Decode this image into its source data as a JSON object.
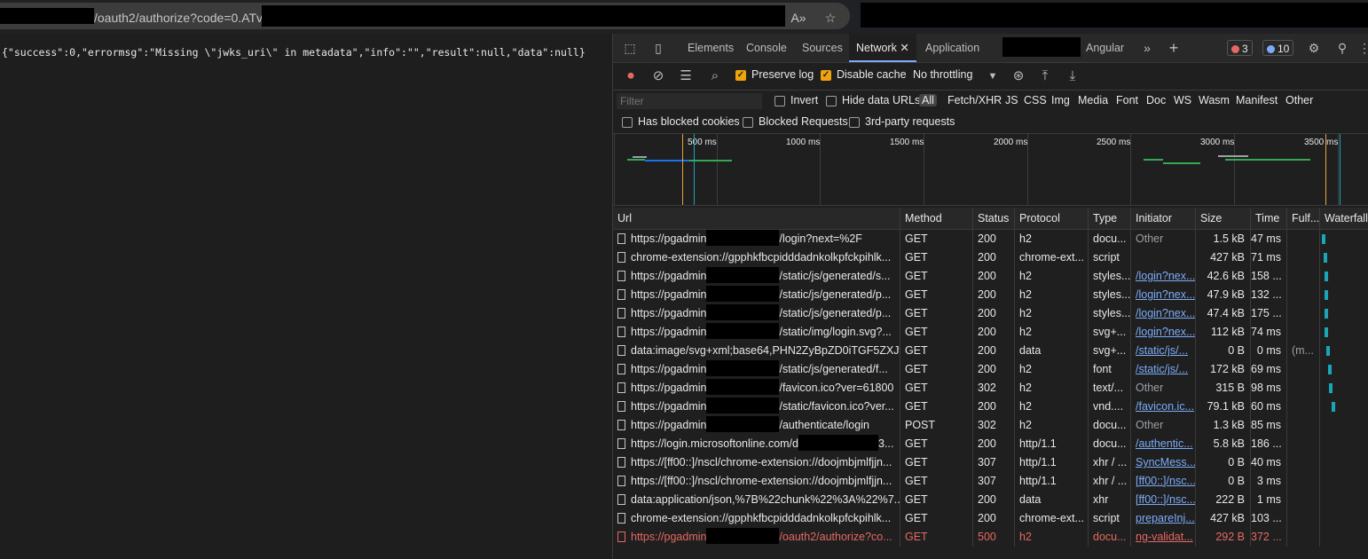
{
  "address_bar": {
    "url": "/oauth2/authorize?code=0.ATv",
    "reader_icon": "reader-mode-icon",
    "favorite_icon": "add-favorite-icon"
  },
  "page": {
    "json_text": "{\"success\":0,\"errormsg\":\"Missing \\\"jwks_uri\\\" in metadata\",\"info\":\"\",\"result\":null,\"data\":null}"
  },
  "devtools": {
    "tabs": [
      "Elements",
      "Console",
      "Sources",
      "Network",
      "Application",
      "Angular"
    ],
    "active_tab": "Network",
    "errors_count": "3",
    "info_count": "10",
    "toolbar": {
      "preserve_log": "Preserve log",
      "disable_cache": "Disable cache",
      "throttling": "No throttling"
    },
    "filter": {
      "placeholder": "Filter",
      "invert": "Invert",
      "hide_data_urls": "Hide data URLs",
      "types": [
        "All",
        "Fetch/XHR",
        "JS",
        "CSS",
        "Img",
        "Media",
        "Font",
        "Doc",
        "WS",
        "Wasm",
        "Manifest",
        "Other"
      ],
      "selected_type": "All"
    },
    "blocked": {
      "has_blocked_cookies": "Has blocked cookies",
      "blocked_requests": "Blocked Requests",
      "third_party": "3rd-party requests"
    },
    "overview_ticks": [
      "500 ms",
      "1000 ms",
      "1500 ms",
      "2000 ms",
      "2500 ms",
      "3000 ms",
      "3500 ms"
    ],
    "columns": [
      "Url",
      "Method",
      "Status",
      "Protocol",
      "Type",
      "Initiator",
      "Size",
      "Time",
      "Fulf...",
      "Waterfall"
    ],
    "rows": [
      {
        "url_a": "https://pgadmin",
        "url_b": "/login?next=%2F",
        "method": "GET",
        "status": "200",
        "protocol": "h2",
        "type": "docu...",
        "initiator": "Other",
        "initiator_link": false,
        "size": "1.5 kB",
        "time": "47 ms",
        "fulfilled": "",
        "redacted": true,
        "error": false
      },
      {
        "url_a": "chrome-extension://gpphkfbcpidddadnkolkpfckpihlk...",
        "url_b": "",
        "method": "GET",
        "status": "200",
        "protocol": "chrome-ext...",
        "type": "script",
        "initiator": "",
        "initiator_link": false,
        "size": "427 kB",
        "time": "71 ms",
        "fulfilled": "",
        "redacted": false,
        "error": false
      },
      {
        "url_a": "https://pgadmin",
        "url_b": "/static/js/generated/s...",
        "method": "GET",
        "status": "200",
        "protocol": "h2",
        "type": "styles...",
        "initiator": "/login?nex...",
        "initiator_link": true,
        "size": "42.6 kB",
        "time": "158 ...",
        "fulfilled": "",
        "redacted": true,
        "error": false
      },
      {
        "url_a": "https://pgadmin",
        "url_b": "/static/js/generated/p...",
        "method": "GET",
        "status": "200",
        "protocol": "h2",
        "type": "styles...",
        "initiator": "/login?nex...",
        "initiator_link": true,
        "size": "47.9 kB",
        "time": "132 ...",
        "fulfilled": "",
        "redacted": true,
        "error": false
      },
      {
        "url_a": "https://pgadmin",
        "url_b": "/static/js/generated/p...",
        "method": "GET",
        "status": "200",
        "protocol": "h2",
        "type": "styles...",
        "initiator": "/login?nex...",
        "initiator_link": true,
        "size": "47.4 kB",
        "time": "175 ...",
        "fulfilled": "",
        "redacted": true,
        "error": false
      },
      {
        "url_a": "https://pgadmin",
        "url_b": "/static/img/login.svg?...",
        "method": "GET",
        "status": "200",
        "protocol": "h2",
        "type": "svg+...",
        "initiator": "/login?nex...",
        "initiator_link": true,
        "size": "112 kB",
        "time": "74 ms",
        "fulfilled": "",
        "redacted": true,
        "error": false
      },
      {
        "url_a": "data:image/svg+xml;base64,PHN2ZyBpZD0iTGF5ZXJf...",
        "url_b": "",
        "method": "GET",
        "status": "200",
        "protocol": "data",
        "type": "svg+...",
        "initiator": "/static/js/...",
        "initiator_link": true,
        "size": "0 B",
        "time": "0 ms",
        "fulfilled": "(m...",
        "redacted": false,
        "error": false
      },
      {
        "url_a": "https://pgadmin",
        "url_b": "/static/js/generated/f...",
        "method": "GET",
        "status": "200",
        "protocol": "h2",
        "type": "font",
        "initiator": "/static/js/...",
        "initiator_link": true,
        "size": "172 kB",
        "time": "69 ms",
        "fulfilled": "",
        "redacted": true,
        "error": false
      },
      {
        "url_a": "https://pgadmin",
        "url_b": "/favicon.ico?ver=61800",
        "method": "GET",
        "status": "302",
        "protocol": "h2",
        "type": "text/...",
        "initiator": "Other",
        "initiator_link": false,
        "size": "315 B",
        "time": "98 ms",
        "fulfilled": "",
        "redacted": true,
        "error": false
      },
      {
        "url_a": "https://pgadmin",
        "url_b": "/static/favicon.ico?ver...",
        "method": "GET",
        "status": "200",
        "protocol": "h2",
        "type": "vnd....",
        "initiator": "/favicon.ic...",
        "initiator_link": true,
        "size": "79.1 kB",
        "time": "60 ms",
        "fulfilled": "",
        "redacted": true,
        "error": false
      },
      {
        "url_a": "https://pgadmin",
        "url_b": "/authenticate/login",
        "method": "POST",
        "status": "302",
        "protocol": "h2",
        "type": "docu...",
        "initiator": "Other",
        "initiator_link": false,
        "size": "1.3 kB",
        "time": "85 ms",
        "fulfilled": "",
        "redacted": true,
        "error": false
      },
      {
        "url_a": "https://login.microsoftonline.com/d",
        "url_b": "3...",
        "method": "GET",
        "status": "200",
        "protocol": "http/1.1",
        "type": "docu...",
        "initiator": "/authentic...",
        "initiator_link": true,
        "size": "5.8 kB",
        "time": "186 ...",
        "fulfilled": "",
        "redacted": true,
        "error": false
      },
      {
        "url_a": "https://[ff00::]/nscl/chrome-extension://doojmbjmlfjjn...",
        "url_b": "",
        "method": "GET",
        "status": "307",
        "protocol": "http/1.1",
        "type": "xhr / ...",
        "initiator": "SyncMess...",
        "initiator_link": true,
        "size": "0 B",
        "time": "40 ms",
        "fulfilled": "",
        "redacted": false,
        "error": false
      },
      {
        "url_a": "https://[ff00::]/nscl/chrome-extension://doojmbjmlfjjn...",
        "url_b": "",
        "method": "GET",
        "status": "307",
        "protocol": "http/1.1",
        "type": "xhr / ...",
        "initiator": "[ff00::]/nsc...",
        "initiator_link": true,
        "size": "0 B",
        "time": "3 ms",
        "fulfilled": "",
        "redacted": false,
        "error": false
      },
      {
        "url_a": "data:application/json,%7B%22chunk%22%3A%22%7...",
        "url_b": "",
        "method": "GET",
        "status": "200",
        "protocol": "data",
        "type": "xhr",
        "initiator": "[ff00::]/nsc...",
        "initiator_link": true,
        "size": "222 B",
        "time": "1 ms",
        "fulfilled": "",
        "redacted": false,
        "error": false
      },
      {
        "url_a": "chrome-extension://gpphkfbcpidddadnkolkpfckpihlk...",
        "url_b": "",
        "method": "GET",
        "status": "200",
        "protocol": "chrome-ext...",
        "type": "script",
        "initiator": "prepareInj...",
        "initiator_link": true,
        "size": "427 kB",
        "time": "103 ...",
        "fulfilled": "",
        "redacted": false,
        "error": false
      },
      {
        "url_a": "https://pgadmin",
        "url_b": "/oauth2/authorize?co...",
        "method": "GET",
        "status": "500",
        "protocol": "h2",
        "type": "docu...",
        "initiator": "ng-validat...",
        "initiator_link": true,
        "size": "292 B",
        "time": "372 ...",
        "fulfilled": "",
        "redacted": true,
        "error": true
      }
    ],
    "colors": {
      "accent": "#7cacf8",
      "error": "#e46962",
      "checkbox": "#f0a30a",
      "waterfall": "#1aa6b7"
    }
  }
}
